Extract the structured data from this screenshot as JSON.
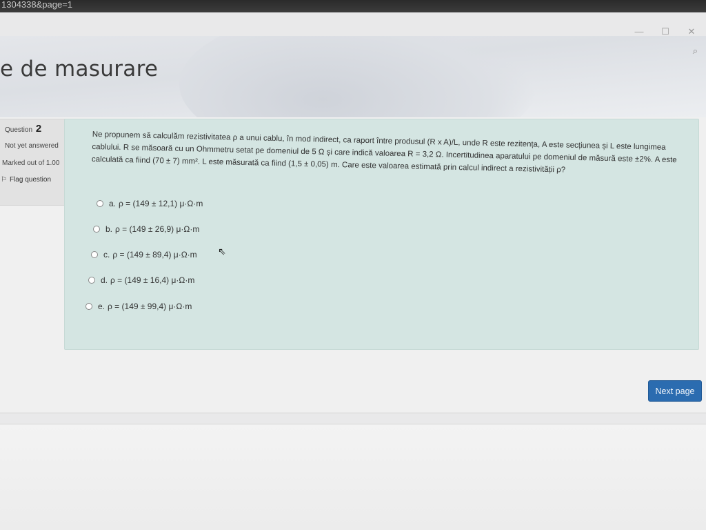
{
  "browser": {
    "url_fragment": "1304338&page=1"
  },
  "header": {
    "title": "e de masurare"
  },
  "question_info": {
    "question_prefix": "Question",
    "question_number": "2",
    "state": "Not yet answered",
    "marked_out_of": "Marked out of 1.00",
    "flag_label": "Flag question"
  },
  "question": {
    "text": "Ne propunem să calculăm rezistivitatea ρ a unui cablu, în mod indirect, ca raport între produsul (R x A)/L, unde R este rezitența, A este secțiunea și L este lungimea cablului. R se măsoară cu un Ohmmetru setat pe domeniul de 5 Ω și care indică valoarea R = 3,2 Ω. Incertitudinea aparatului pe domeniul de măsură este ±2%. A este calculată ca fiind (70 ± 7) mm². L este măsurată ca fiind (1,5 ± 0,05) m. Care este valoarea estimată prin calcul indirect a rezistivității ρ?",
    "answers": [
      {
        "letter": "a.",
        "text": "ρ = (149 ± 12,1) μ·Ω·m"
      },
      {
        "letter": "b.",
        "text": "ρ = (149 ± 26,9) μ·Ω·m"
      },
      {
        "letter": "c.",
        "text": "ρ = (149 ± 89,4) μ·Ω·m"
      },
      {
        "letter": "d.",
        "text": "ρ = (149 ± 16,4) μ·Ω·m"
      },
      {
        "letter": "e.",
        "text": "ρ = (149 ± 99,4) μ·Ω·m"
      }
    ]
  },
  "nav": {
    "next_label": "Next page"
  },
  "icons": {
    "minimize": "minimize-icon",
    "maximize": "maximize-icon",
    "close": "close-icon",
    "search": "search-icon",
    "flag": "flag-icon",
    "cursor": "cursor-icon"
  },
  "colors": {
    "question_bg": "#d4e5e2",
    "next_button": "#2b6cb0"
  }
}
